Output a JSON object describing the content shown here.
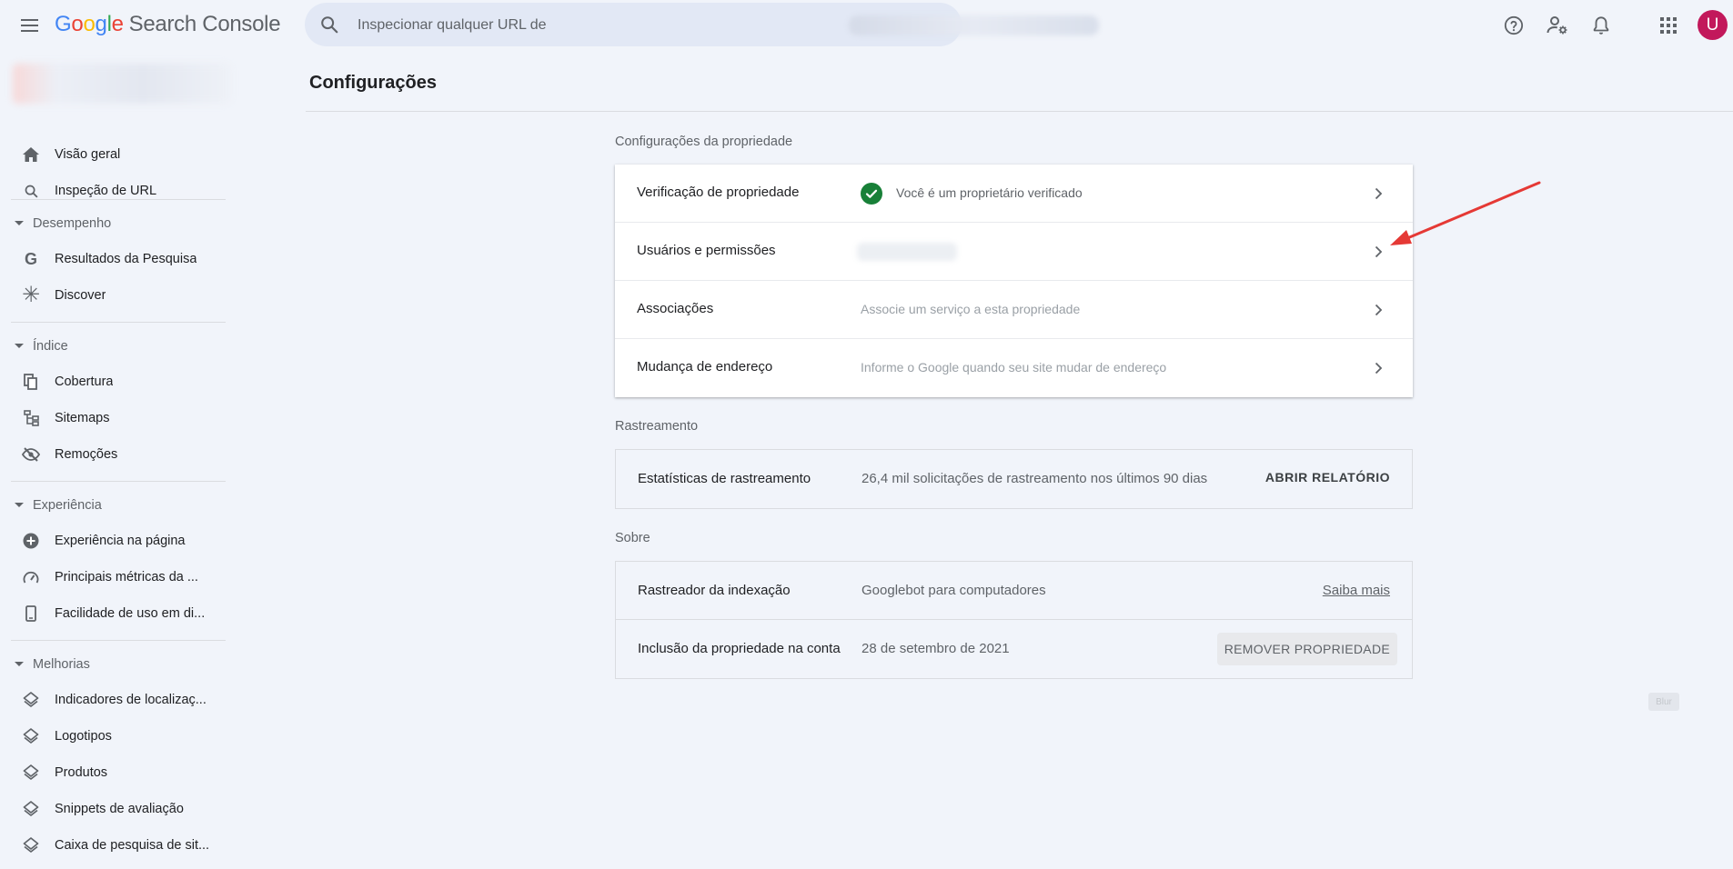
{
  "header": {
    "logo": {
      "g1": "G",
      "o1": "o",
      "o2": "o",
      "g2": "g",
      "l": "l",
      "e": "e",
      "product": "Search Console"
    },
    "search_placeholder": "Inspecionar qualquer URL de",
    "avatar_letter": "U",
    "icons": [
      "help-icon",
      "manage-users-icon",
      "notifications-icon",
      "apps-grid-icon"
    ]
  },
  "sidebar": {
    "top_items": [
      {
        "label": "Visão geral",
        "icon": "home-icon"
      },
      {
        "label": "Inspeção de URL",
        "icon": "search-icon"
      }
    ],
    "sections": [
      {
        "title": "Desempenho",
        "items": [
          {
            "label": "Resultados da Pesquisa",
            "icon": "google-g-icon"
          },
          {
            "label": "Discover",
            "icon": "asterisk-icon"
          }
        ]
      },
      {
        "title": "Índice",
        "items": [
          {
            "label": "Cobertura",
            "icon": "file-copy-icon"
          },
          {
            "label": "Sitemaps",
            "icon": "sitemap-icon"
          },
          {
            "label": "Remoções",
            "icon": "visibility-off-icon"
          }
        ]
      },
      {
        "title": "Experiência",
        "items": [
          {
            "label": "Experiência na página",
            "icon": "add-circle-icon"
          },
          {
            "label": "Principais métricas da ...",
            "icon": "speed-icon"
          },
          {
            "label": "Facilidade de uso em di...",
            "icon": "smartphone-icon"
          }
        ]
      },
      {
        "title": "Melhorias",
        "items": [
          {
            "label": "Indicadores de localizaç...",
            "icon": "layers-icon"
          },
          {
            "label": "Logotipos",
            "icon": "layers-icon"
          },
          {
            "label": "Produtos",
            "icon": "layers-icon"
          },
          {
            "label": "Snippets de avaliação",
            "icon": "layers-icon"
          },
          {
            "label": "Caixa de pesquisa de sit...",
            "icon": "layers-icon"
          }
        ]
      }
    ]
  },
  "main": {
    "title": "Configurações",
    "property_section": {
      "label": "Configurações da propriedade",
      "rows": [
        {
          "label": "Verificação de propriedade",
          "value": "Você é um proprietário verificado"
        },
        {
          "label": "Usuários e permissões",
          "value": ""
        },
        {
          "label": "Associações",
          "value": "Associe um serviço a esta propriedade"
        },
        {
          "label": "Mudança de endereço",
          "value": "Informe o Google quando seu site mudar de endereço"
        }
      ]
    },
    "crawl_section": {
      "label": "Rastreamento",
      "row": {
        "label": "Estatísticas de rastreamento",
        "value": "26,4 mil solicitações de rastreamento nos últimos 90 dias",
        "action": "ABRIR RELATÓRIO"
      }
    },
    "about_section": {
      "label": "Sobre",
      "rows": [
        {
          "label": "Rastreador da indexação",
          "value": "Googlebot para computadores",
          "action": "Saiba mais"
        },
        {
          "label": "Inclusão da propriedade na conta",
          "value": "28 de setembro de 2021",
          "action": "REMOVER PROPRIEDADE"
        }
      ]
    },
    "blur_tag": "Blur"
  },
  "colors": {
    "accent_green": "#188038",
    "avatar": "#c2185b",
    "arrow": "#e53935",
    "background": "#f1f4fa"
  }
}
